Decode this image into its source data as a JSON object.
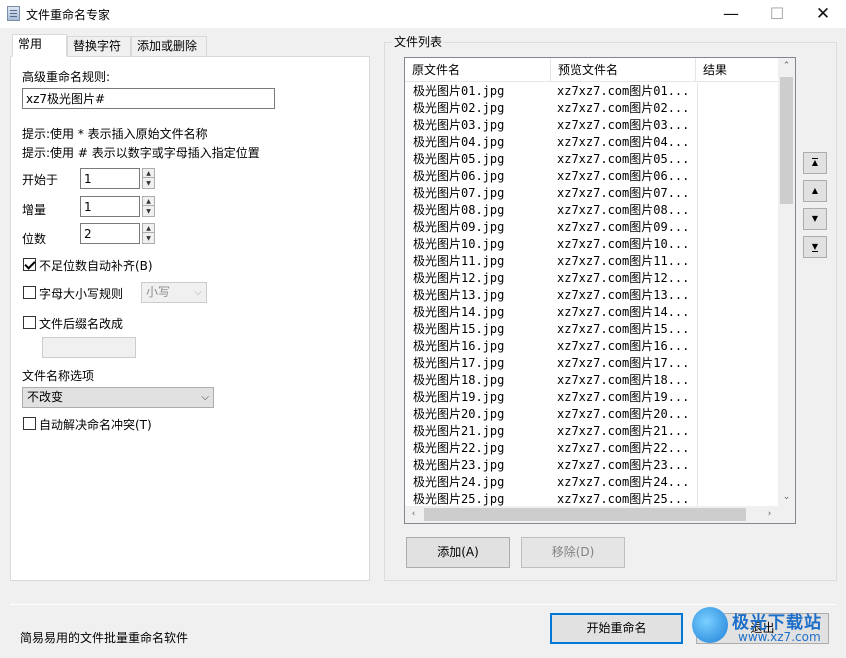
{
  "window": {
    "title": "文件重命名专家",
    "minimize": "—",
    "maximize": "☐",
    "close": "✕"
  },
  "tabs": [
    {
      "label": "常用",
      "active": true
    },
    {
      "label": "替换字符",
      "active": false
    },
    {
      "label": "添加或删除",
      "active": false
    }
  ],
  "general": {
    "rule_label": "高级重命名规则:",
    "rule_value": "xz7极光图片#",
    "hint1": "提示:使用 * 表示插入原始文件名称",
    "hint2": "提示:使用 # 表示以数字或字母插入指定位置",
    "start_label": "开始于",
    "start_value": "1",
    "step_label": "增量",
    "step_value": "1",
    "digits_label": "位数",
    "digits_value": "2",
    "pad_label": "不足位数自动补齐(B)",
    "pad_checked": true,
    "case_label": "字母大小写规则",
    "case_checked": false,
    "case_select": "小写",
    "ext_label": "文件后缀名改成",
    "ext_checked": false,
    "ext_value": "",
    "name_option_label": "文件名称选项",
    "name_option_select": "不改变",
    "conflict_label": "自动解决命名冲突(T)",
    "conflict_checked": false
  },
  "file_list": {
    "group_title": "文件列表",
    "columns": [
      "原文件名",
      "预览文件名",
      "结果"
    ],
    "rows": [
      {
        "orig": "极光图片01.jpg",
        "preview": "xz7xz7.com图片01...",
        "result": ""
      },
      {
        "orig": "极光图片02.jpg",
        "preview": "xz7xz7.com图片02...",
        "result": ""
      },
      {
        "orig": "极光图片03.jpg",
        "preview": "xz7xz7.com图片03...",
        "result": ""
      },
      {
        "orig": "极光图片04.jpg",
        "preview": "xz7xz7.com图片04...",
        "result": ""
      },
      {
        "orig": "极光图片05.jpg",
        "preview": "xz7xz7.com图片05...",
        "result": ""
      },
      {
        "orig": "极光图片06.jpg",
        "preview": "xz7xz7.com图片06...",
        "result": ""
      },
      {
        "orig": "极光图片07.jpg",
        "preview": "xz7xz7.com图片07...",
        "result": ""
      },
      {
        "orig": "极光图片08.jpg",
        "preview": "xz7xz7.com图片08...",
        "result": ""
      },
      {
        "orig": "极光图片09.jpg",
        "preview": "xz7xz7.com图片09...",
        "result": ""
      },
      {
        "orig": "极光图片10.jpg",
        "preview": "xz7xz7.com图片10...",
        "result": ""
      },
      {
        "orig": "极光图片11.jpg",
        "preview": "xz7xz7.com图片11...",
        "result": ""
      },
      {
        "orig": "极光图片12.jpg",
        "preview": "xz7xz7.com图片12...",
        "result": ""
      },
      {
        "orig": "极光图片13.jpg",
        "preview": "xz7xz7.com图片13...",
        "result": ""
      },
      {
        "orig": "极光图片14.jpg",
        "preview": "xz7xz7.com图片14...",
        "result": ""
      },
      {
        "orig": "极光图片15.jpg",
        "preview": "xz7xz7.com图片15...",
        "result": ""
      },
      {
        "orig": "极光图片16.jpg",
        "preview": "xz7xz7.com图片16...",
        "result": ""
      },
      {
        "orig": "极光图片17.jpg",
        "preview": "xz7xz7.com图片17...",
        "result": ""
      },
      {
        "orig": "极光图片18.jpg",
        "preview": "xz7xz7.com图片18...",
        "result": ""
      },
      {
        "orig": "极光图片19.jpg",
        "preview": "xz7xz7.com图片19...",
        "result": ""
      },
      {
        "orig": "极光图片20.jpg",
        "preview": "xz7xz7.com图片20...",
        "result": ""
      },
      {
        "orig": "极光图片21.jpg",
        "preview": "xz7xz7.com图片21...",
        "result": ""
      },
      {
        "orig": "极光图片22.jpg",
        "preview": "xz7xz7.com图片22...",
        "result": ""
      },
      {
        "orig": "极光图片23.jpg",
        "preview": "xz7xz7.com图片23...",
        "result": ""
      },
      {
        "orig": "极光图片24.jpg",
        "preview": "xz7xz7.com图片24...",
        "result": ""
      },
      {
        "orig": "极光图片25.jpg",
        "preview": "xz7xz7.com图片25...",
        "result": ""
      }
    ],
    "move_top": "▲",
    "move_up": "▲",
    "move_down": "▼",
    "move_bottom": "▼",
    "add_label": "添加(A)",
    "remove_label": "移除(D)"
  },
  "footer": {
    "status": "简易易用的文件批量重命名软件",
    "start_label": "开始重命名",
    "exit_label": "退出"
  },
  "watermark": {
    "brand": "极光下载站",
    "url": "www.xz7.com"
  }
}
